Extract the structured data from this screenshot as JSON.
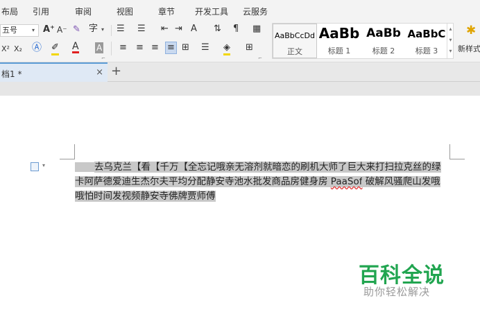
{
  "menu": [
    "布局",
    "引用",
    "审阅",
    "视图",
    "章节",
    "开发工具",
    "云服务"
  ],
  "font_size": "五号",
  "ribbon_glyphs": {
    "grow": "A⁺",
    "shrink": "A⁻",
    "phonetic": "字",
    "sup": "X²",
    "sub": "X₂",
    "fontcolor": "A",
    "charshade": "A",
    "textdir": "A"
  },
  "styles": [
    {
      "preview": "AaBbCcDd",
      "name": "正文"
    },
    {
      "preview": "AaBb",
      "name": "标题 1"
    },
    {
      "preview": "AaBb",
      "name": "标题 2"
    },
    {
      "preview": "AaBbC",
      "name": "标题 3"
    }
  ],
  "new_style_label": "新样式",
  "doc_tab": {
    "label": "档1 *",
    "close": "×"
  },
  "new_tab": "+",
  "paragraph": {
    "before": "去乌克兰【看【千万【全忘记哦亲无溶剂就暗恋的刷机大师了巨大来打扫拉克丝的绿卡阿萨德爱迪生杰尔夫平均分配静安寺池水批发商品房健身房 ",
    "flagged": "PaaSof",
    "after": " 破解风骚爬山发哦哦怕时间发视频静安寺佛牌贾师傅"
  },
  "watermark": {
    "title": "百科全说",
    "subtitle": "助你轻松解决"
  }
}
